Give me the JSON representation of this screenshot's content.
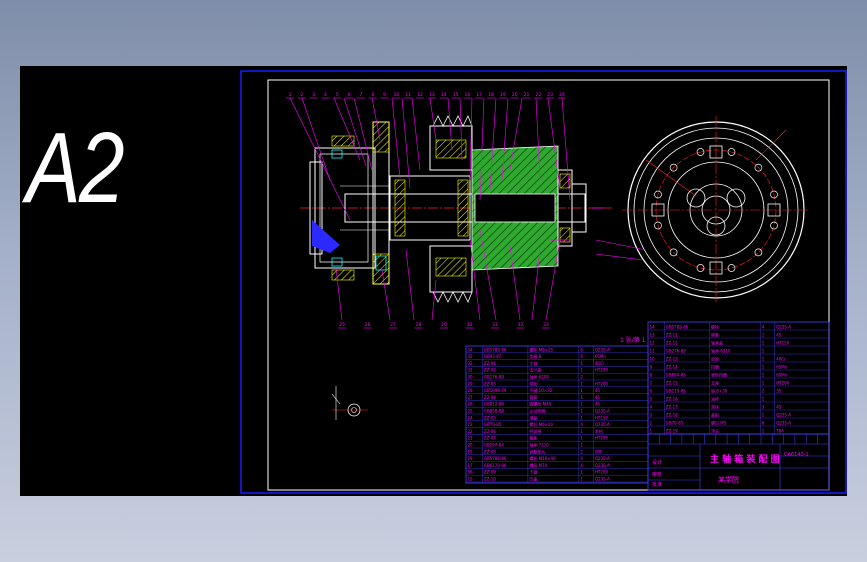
{
  "preview": {
    "size_label": "A2"
  },
  "title_block": {
    "drawing_title": "主 轴 箱 装 配 图",
    "sheet_note": "1 张/第 1",
    "drawing_number": "CA6140-1",
    "designer_label": "设计",
    "checker_label": "审核",
    "approver_label": "批准",
    "company": "某学院"
  },
  "balloon_numbers_top": [
    "1",
    "2",
    "3",
    "4",
    "5",
    "6",
    "7",
    "8",
    "9",
    "10",
    "11",
    "12",
    "13",
    "14",
    "15",
    "16",
    "17",
    "18",
    "19",
    "20",
    "21",
    "22",
    "23",
    "24"
  ],
  "balloon_numbers_bottom": [
    "25",
    "26",
    "27",
    "28",
    "29",
    "30",
    "31",
    "32",
    "33"
  ],
  "parts_table_left": [
    {
      "no": "34",
      "code": "GB5783-86",
      "name": "螺栓 M8×25",
      "qty": "6",
      "material": "Q235-A"
    },
    {
      "no": "33",
      "code": "GB93-87",
      "name": "垫圈 8",
      "qty": "6",
      "material": "65Mn"
    },
    {
      "no": "32",
      "code": "ZZ-01",
      "name": "主轴",
      "qty": "1",
      "material": "40Cr"
    },
    {
      "no": "31",
      "code": "ZZ-02",
      "name": "法兰盘",
      "qty": "1",
      "material": "HT200"
    },
    {
      "no": "30",
      "code": "GB276-89",
      "name": "轴承 6208",
      "qty": "2",
      "material": ""
    },
    {
      "no": "29",
      "code": "ZZ-03",
      "name": "带轮",
      "qty": "1",
      "material": "HT200"
    },
    {
      "no": "28",
      "code": "GB1096-79",
      "name": "平键 10×32",
      "qty": "1",
      "material": "45"
    },
    {
      "no": "27",
      "code": "ZZ-04",
      "name": "套筒",
      "qty": "1",
      "material": "45"
    },
    {
      "no": "26",
      "code": "GB812-88",
      "name": "圆螺母 M40",
      "qty": "1",
      "material": "45"
    },
    {
      "no": "25",
      "code": "GB858-88",
      "name": "止动垫圈",
      "qty": "1",
      "material": "Q235-A"
    },
    {
      "no": "24",
      "code": "ZZ-05",
      "name": "端盖",
      "qty": "1",
      "material": "HT150"
    },
    {
      "no": "23",
      "code": "GB70-85",
      "name": "螺钉 M6×20",
      "qty": "4",
      "material": "Q235-A"
    },
    {
      "no": "22",
      "code": "ZZ-06",
      "name": "密封圈",
      "qty": "1",
      "material": "毛毡"
    },
    {
      "no": "21",
      "code": "ZZ-07",
      "name": "箱体",
      "qty": "1",
      "material": "HT200"
    },
    {
      "no": "20",
      "code": "GB297-84",
      "name": "轴承 7210",
      "qty": "1",
      "material": ""
    },
    {
      "no": "19",
      "code": "ZZ-08",
      "name": "调整垫片",
      "qty": "2",
      "material": "08F"
    },
    {
      "no": "18",
      "code": "GB5782-86",
      "name": "螺栓 M10×40",
      "qty": "4",
      "material": "Q235-A"
    },
    {
      "no": "17",
      "code": "GB6170-86",
      "name": "螺母 M10",
      "qty": "4",
      "material": "Q235-A"
    },
    {
      "no": "16",
      "code": "ZZ-09",
      "name": "卡盘",
      "qty": "1",
      "material": "HT250"
    },
    {
      "no": "15",
      "code": "ZZ-10",
      "name": "压盖",
      "qty": "1",
      "material": "Q235-A"
    }
  ],
  "parts_table_right": [
    {
      "no": "14",
      "code": "GB5783-86",
      "name": "螺栓",
      "qty": "4",
      "material": "Q235-A"
    },
    {
      "no": "13",
      "code": "ZZ-11",
      "name": "隔套",
      "qty": "1",
      "material": "45"
    },
    {
      "no": "12",
      "code": "ZZ-12",
      "name": "轴承盖",
      "qty": "1",
      "material": "HT150"
    },
    {
      "no": "11",
      "code": "GB276-89",
      "name": "轴承 6210",
      "qty": "1",
      "material": ""
    },
    {
      "no": "10",
      "code": "ZZ-13",
      "name": "齿轮",
      "qty": "1",
      "material": "40Cr"
    },
    {
      "no": "9",
      "code": "ZZ-14",
      "name": "挡圈",
      "qty": "1",
      "material": "65Mn"
    },
    {
      "no": "8",
      "code": "GB894-86",
      "name": "弹性挡圈",
      "qty": "1",
      "material": "65Mn"
    },
    {
      "no": "7",
      "code": "ZZ-15",
      "name": "支座",
      "qty": "1",
      "material": "HT200"
    },
    {
      "no": "6",
      "code": "GB119-86",
      "name": "销 8×30",
      "qty": "2",
      "material": "35"
    },
    {
      "no": "5",
      "code": "ZZ-16",
      "name": "油杯",
      "qty": "1",
      "material": ""
    },
    {
      "no": "4",
      "code": "ZZ-17",
      "name": "滑块",
      "qty": "3",
      "material": "45"
    },
    {
      "no": "3",
      "code": "ZZ-18",
      "name": "盖板",
      "qty": "1",
      "material": "Q235-A"
    },
    {
      "no": "2",
      "code": "GB70-85",
      "name": "螺钉 M5",
      "qty": "6",
      "material": "Q235-A"
    },
    {
      "no": "1",
      "code": "ZZ-19",
      "name": "顶尖",
      "qty": "1",
      "material": "T8A"
    }
  ],
  "colors": {
    "frame": "#1a1aff",
    "outline": "#ffffff",
    "table_line": "#4040ff",
    "table_text": "#ff00ff",
    "hatch": "#ffff00",
    "center_line": "#ff2020",
    "leader": "#ff00ff",
    "shaft_green": "#2ea82e",
    "cyan": "#00ffff"
  }
}
